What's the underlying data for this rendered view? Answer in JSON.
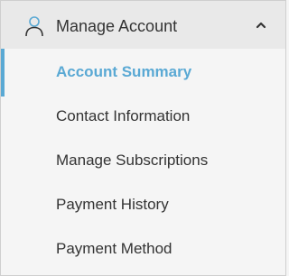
{
  "header": {
    "title": "Manage Account",
    "icon": "user-icon",
    "chevron_icon": "chevron-up-icon",
    "expanded": true
  },
  "menu": {
    "items": [
      {
        "label": "Account Summary",
        "active": true
      },
      {
        "label": "Contact Information",
        "active": false
      },
      {
        "label": "Manage Subscriptions",
        "active": false
      },
      {
        "label": "Payment History",
        "active": false
      },
      {
        "label": "Payment Method",
        "active": false
      }
    ]
  },
  "colors": {
    "accent": "#5aa9d4",
    "text": "#333333",
    "header_bg": "#e9e9e9",
    "panel_bg": "#f5f5f5"
  }
}
